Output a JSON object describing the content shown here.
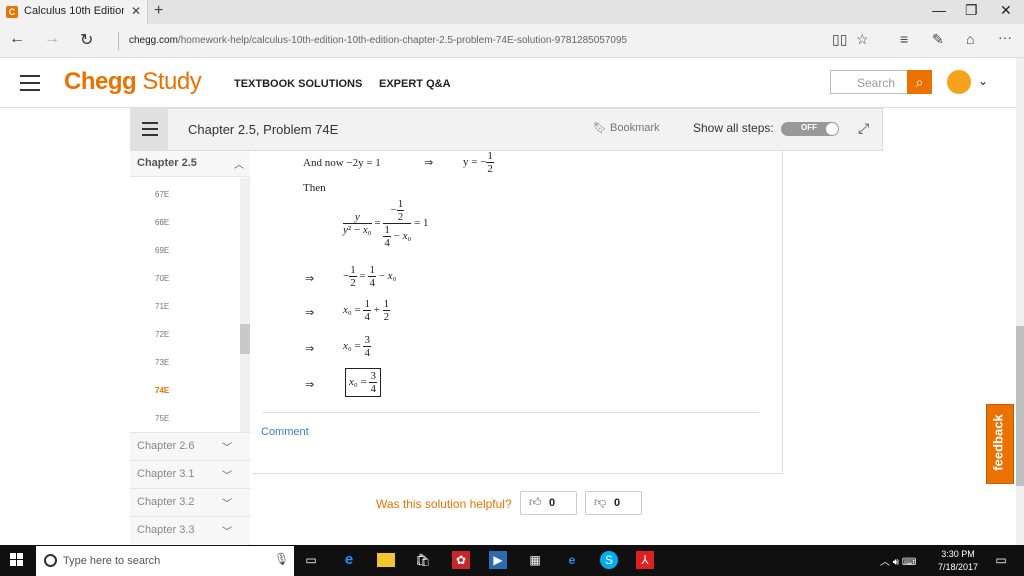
{
  "browser": {
    "tab_title": "Calculus 10th Edition Ch",
    "tab_favicon": "C",
    "url_domain": "chegg.com",
    "url_path": "/homework-help/calculus-10th-edition-10th-edition-chapter-2.5-problem-74E-solution-9781285057095"
  },
  "header": {
    "logo_chegg": "Chegg",
    "logo_study": "Study",
    "nav_textbook": "TEXTBOOK SOLUTIONS",
    "nav_expert": "EXPERT Q&A",
    "search_placeholder": "Search"
  },
  "chapter_bar": {
    "title": "Chapter 2.5, Problem 74E",
    "bookmark": "Bookmark",
    "show_steps": "Show all steps:",
    "toggle": "OFF"
  },
  "sidebar": {
    "current_chapter": "Chapter 2.5",
    "problems": [
      "67E",
      "68E",
      "69E",
      "70E",
      "71E",
      "72E",
      "73E",
      "74E",
      "75E"
    ],
    "active_problem": "74E",
    "chapters": [
      "Chapter 2.6",
      "Chapter 3.1",
      "Chapter 3.2",
      "Chapter 3.3"
    ]
  },
  "solution": {
    "line1_text": "And now −2y = 1",
    "line1_result": "y = −",
    "then": "Then",
    "comment": "Comment"
  },
  "feedback": {
    "helpful": "Was this solution helpful?",
    "up_count": "0",
    "down_count": "0",
    "tab": "feedback"
  },
  "taskbar": {
    "search_placeholder": "Type here to search",
    "time": "3:30 PM",
    "date": "7/18/2017"
  },
  "colors": {
    "brand": "#eb7100",
    "link": "#3a7fbf"
  }
}
